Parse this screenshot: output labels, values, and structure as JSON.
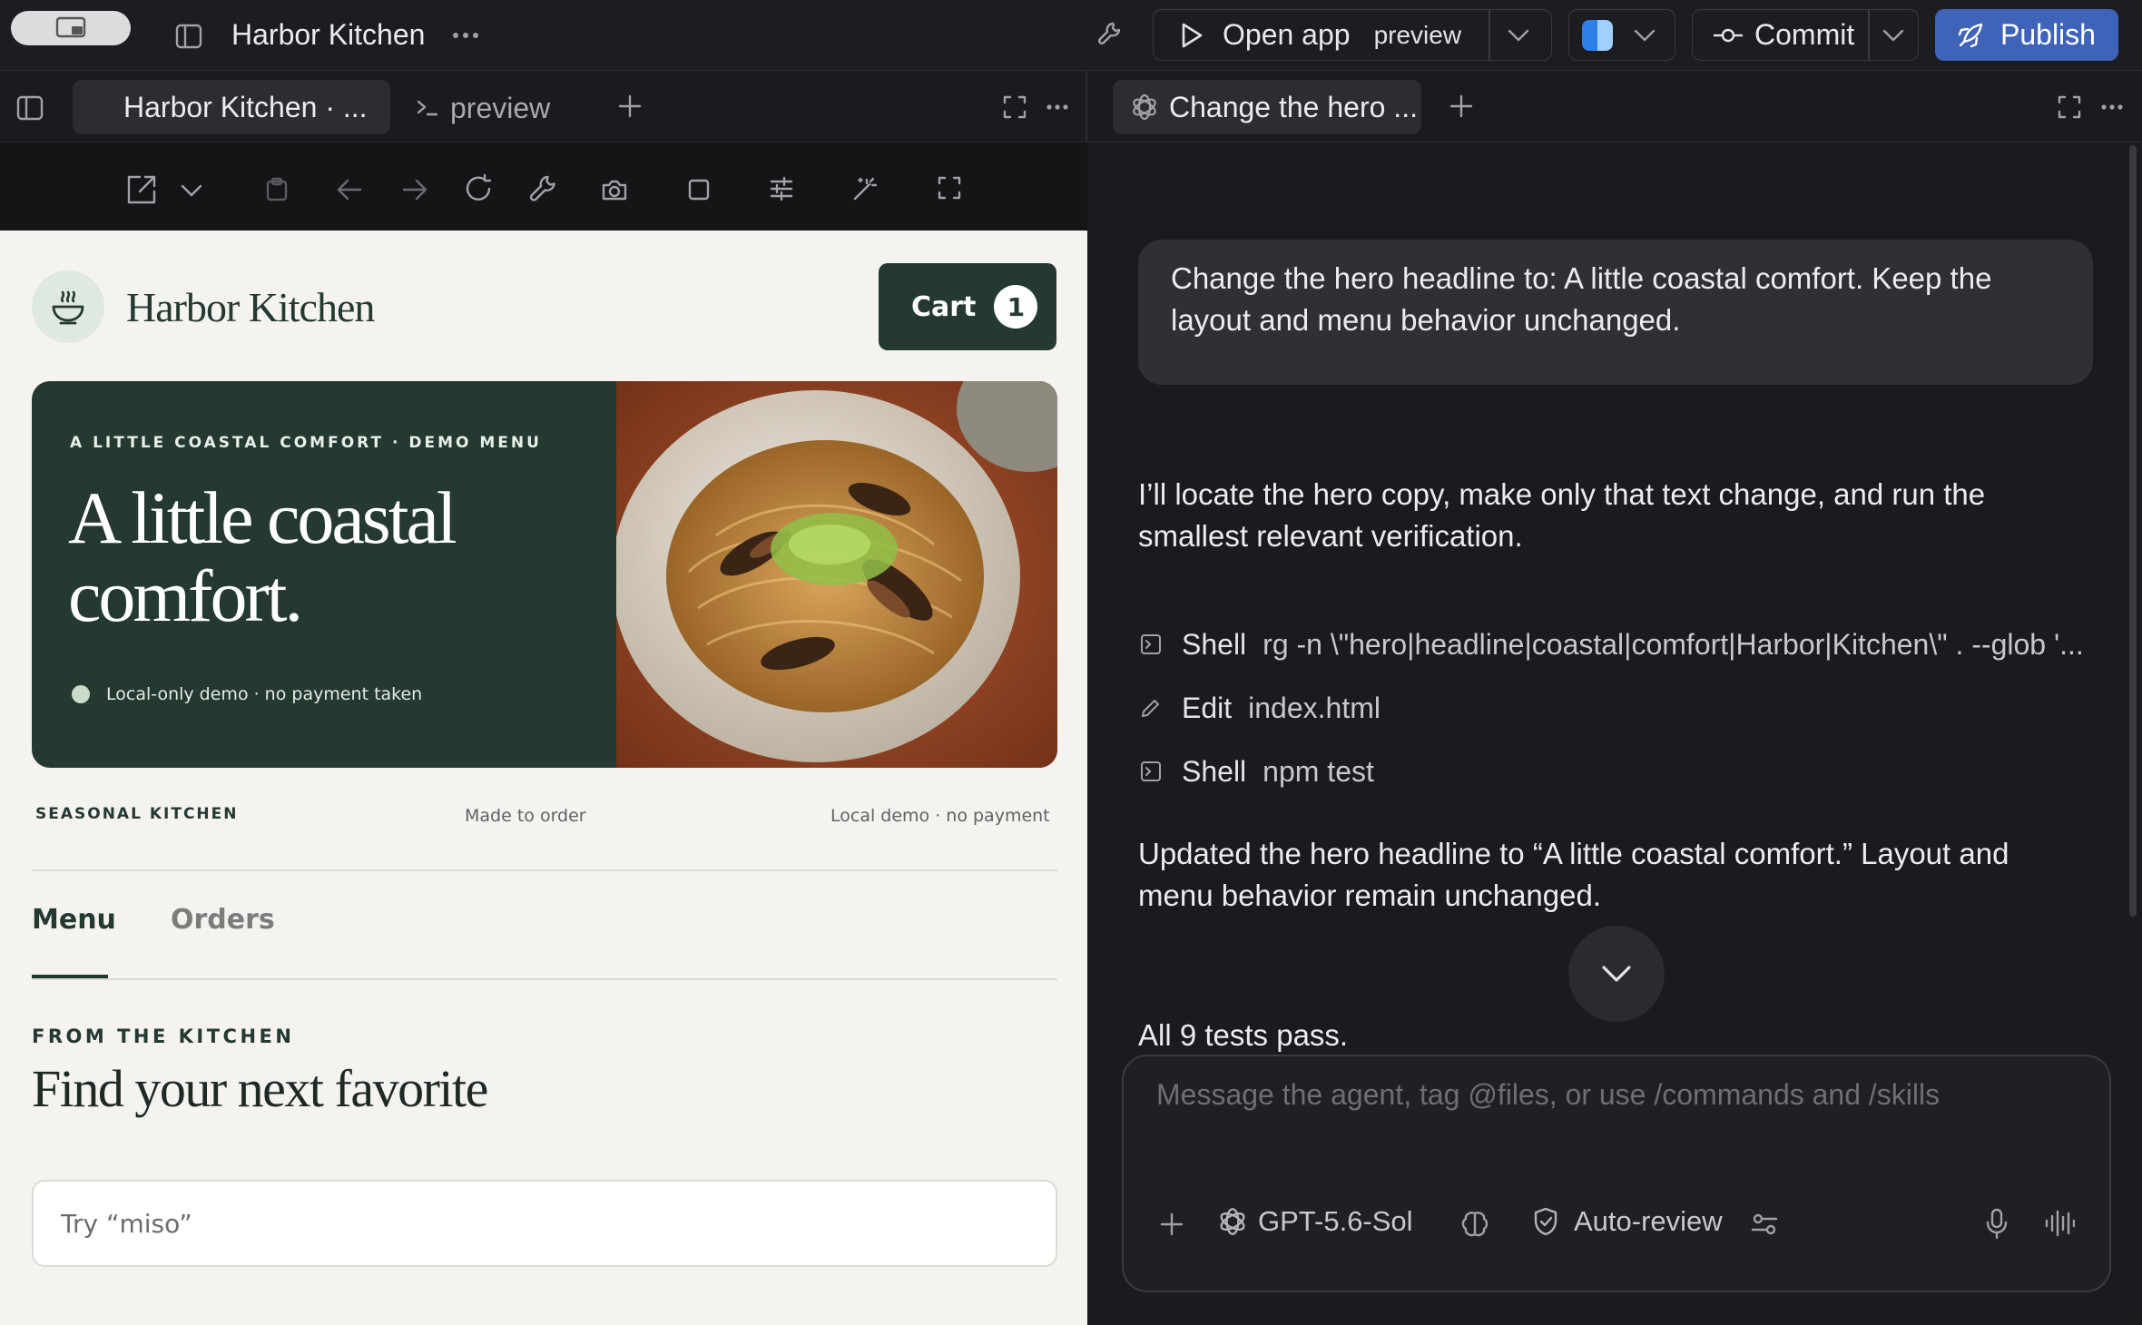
{
  "topbar": {
    "project_title": "Harbor Kitchen",
    "open_app_label": "Open app",
    "open_app_target": "preview",
    "commit_label": "Commit",
    "publish_label": "Publish"
  },
  "left_tabs": {
    "active_tab": "Harbor Kitchen · ...",
    "terminal_tab": "preview"
  },
  "right_tabs": {
    "active_tab": "Change the hero ..."
  },
  "site": {
    "brand": "Harbor Kitchen",
    "cart_label": "Cart",
    "cart_count": "1",
    "hero_eyebrow": "A LITTLE COASTAL COMFORT · DEMO MENU",
    "hero_headline_line1": "A little coastal",
    "hero_headline_line2": "comfort.",
    "hero_note": "Local-only demo · no payment taken",
    "info_left": "SEASONAL KITCHEN",
    "info_mid": "Made to order",
    "info_right": "Local demo · no payment",
    "tabs": [
      "Menu",
      "Orders"
    ],
    "section_eyebrow": "FROM THE KITCHEN",
    "section_title": "Find your next favorite",
    "search_placeholder": "Try “miso”"
  },
  "chat": {
    "user_message": "Change the hero headline to: A little coastal comfort. Keep the layout and menu behavior unchanged.",
    "agent_intro": "I’ll locate the hero copy, make only that text change, and run the smallest relevant verification.",
    "tool_calls": [
      {
        "type": "Shell",
        "arg": "rg -n \\\"hero|headline|coastal|comfort|Harbor|Kitchen\\\" . --glob '..."
      },
      {
        "type": "Edit",
        "arg": "index.html"
      },
      {
        "type": "Shell",
        "arg": "npm test"
      }
    ],
    "agent_result": "Updated the hero headline to “A little coastal comfort.” Layout and menu behavior remain unchanged.",
    "agent_tests": "All 9 tests pass.",
    "composer_placeholder": "Message the agent, tag @files, or use /commands and /skills",
    "model_label": "GPT-5.6-Sol",
    "review_label": "Auto-review"
  },
  "colors": {
    "publish_bg": "#3e63b8",
    "hero_green": "#24392f",
    "cart_green": "#24392f",
    "accent_mint": "#d6e9dc"
  }
}
